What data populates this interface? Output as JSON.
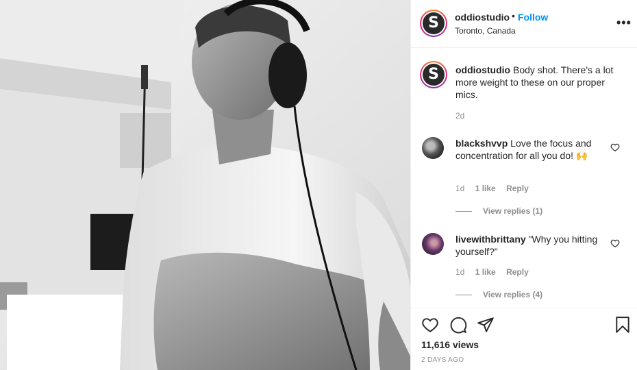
{
  "header": {
    "username": "oddiostudio",
    "separator": "•",
    "follow_label": "Follow",
    "location": "Toronto, Canada",
    "more_label": "•••",
    "avatar_letter": "S"
  },
  "caption": {
    "username": "oddiostudio",
    "text": "Body shot. There's a lot more weight to these on our proper mics.",
    "time": "2d"
  },
  "comments": [
    {
      "username": "blackshvvp",
      "text": "Love the focus and concentration for all you do!",
      "emoji": "🙌",
      "time": "1d",
      "likes": "1 like",
      "reply": "Reply",
      "view_replies": "View replies (1)"
    },
    {
      "username": "livewithbrittany",
      "text": "\"Why you hitting yourself?\"",
      "time": "1d",
      "likes": "1 like",
      "reply": "Reply",
      "view_replies": "View replies (4)"
    }
  ],
  "actions": {
    "like_icon": "heart-icon",
    "comment_icon": "comment-icon",
    "share_icon": "paper-plane-icon",
    "save_icon": "bookmark-icon"
  },
  "views": "11,616 views",
  "posted": "2 DAYS AGO",
  "colors": {
    "accent": "#0095f6",
    "text": "#262626",
    "muted": "#8e8e8e",
    "border": "#efefef"
  }
}
